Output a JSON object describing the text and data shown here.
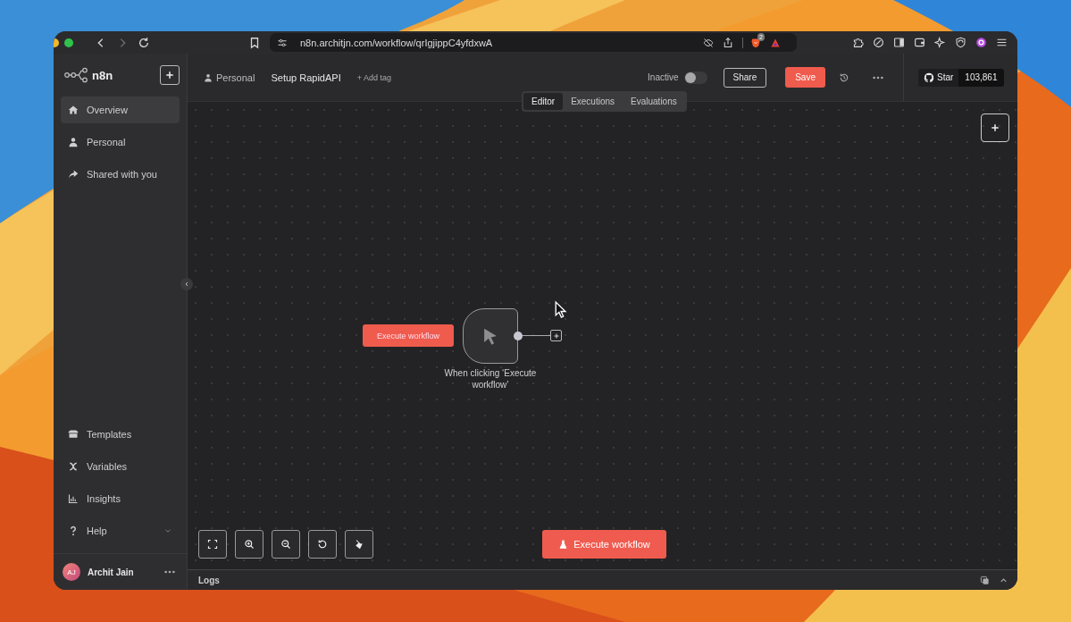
{
  "browser": {
    "url": "n8n.architjn.com/workflow/qrIgjippC4yfdxwA",
    "shields_badge": "2"
  },
  "sidebar": {
    "logo": "n8n",
    "items": [
      {
        "label": "Overview",
        "selected": true
      },
      {
        "label": "Personal",
        "selected": false
      },
      {
        "label": "Shared with you",
        "selected": false
      }
    ],
    "bottom_items": [
      {
        "label": "Templates"
      },
      {
        "label": "Variables"
      },
      {
        "label": "Insights"
      }
    ],
    "help": {
      "label": "Help",
      "expanded": false
    },
    "user": {
      "initials": "AJ",
      "name": "Archit Jain"
    }
  },
  "header": {
    "project": "Personal",
    "workflow_name": "Setup RapidAPI",
    "add_tag": "+ Add tag",
    "status_label": "Inactive",
    "active": false,
    "share": "Share",
    "save": "Save",
    "github": {
      "label": "Star",
      "count": "103,861"
    }
  },
  "view_tabs": [
    {
      "label": "Editor",
      "selected": true
    },
    {
      "label": "Executions",
      "selected": false
    },
    {
      "label": "Evaluations",
      "selected": false
    }
  ],
  "canvas": {
    "trigger_button": "Execute workflow",
    "node": {
      "label": "When clicking ‘Execute workflow’"
    },
    "execute_button": "Execute workflow"
  },
  "logs": {
    "title": "Logs"
  }
}
